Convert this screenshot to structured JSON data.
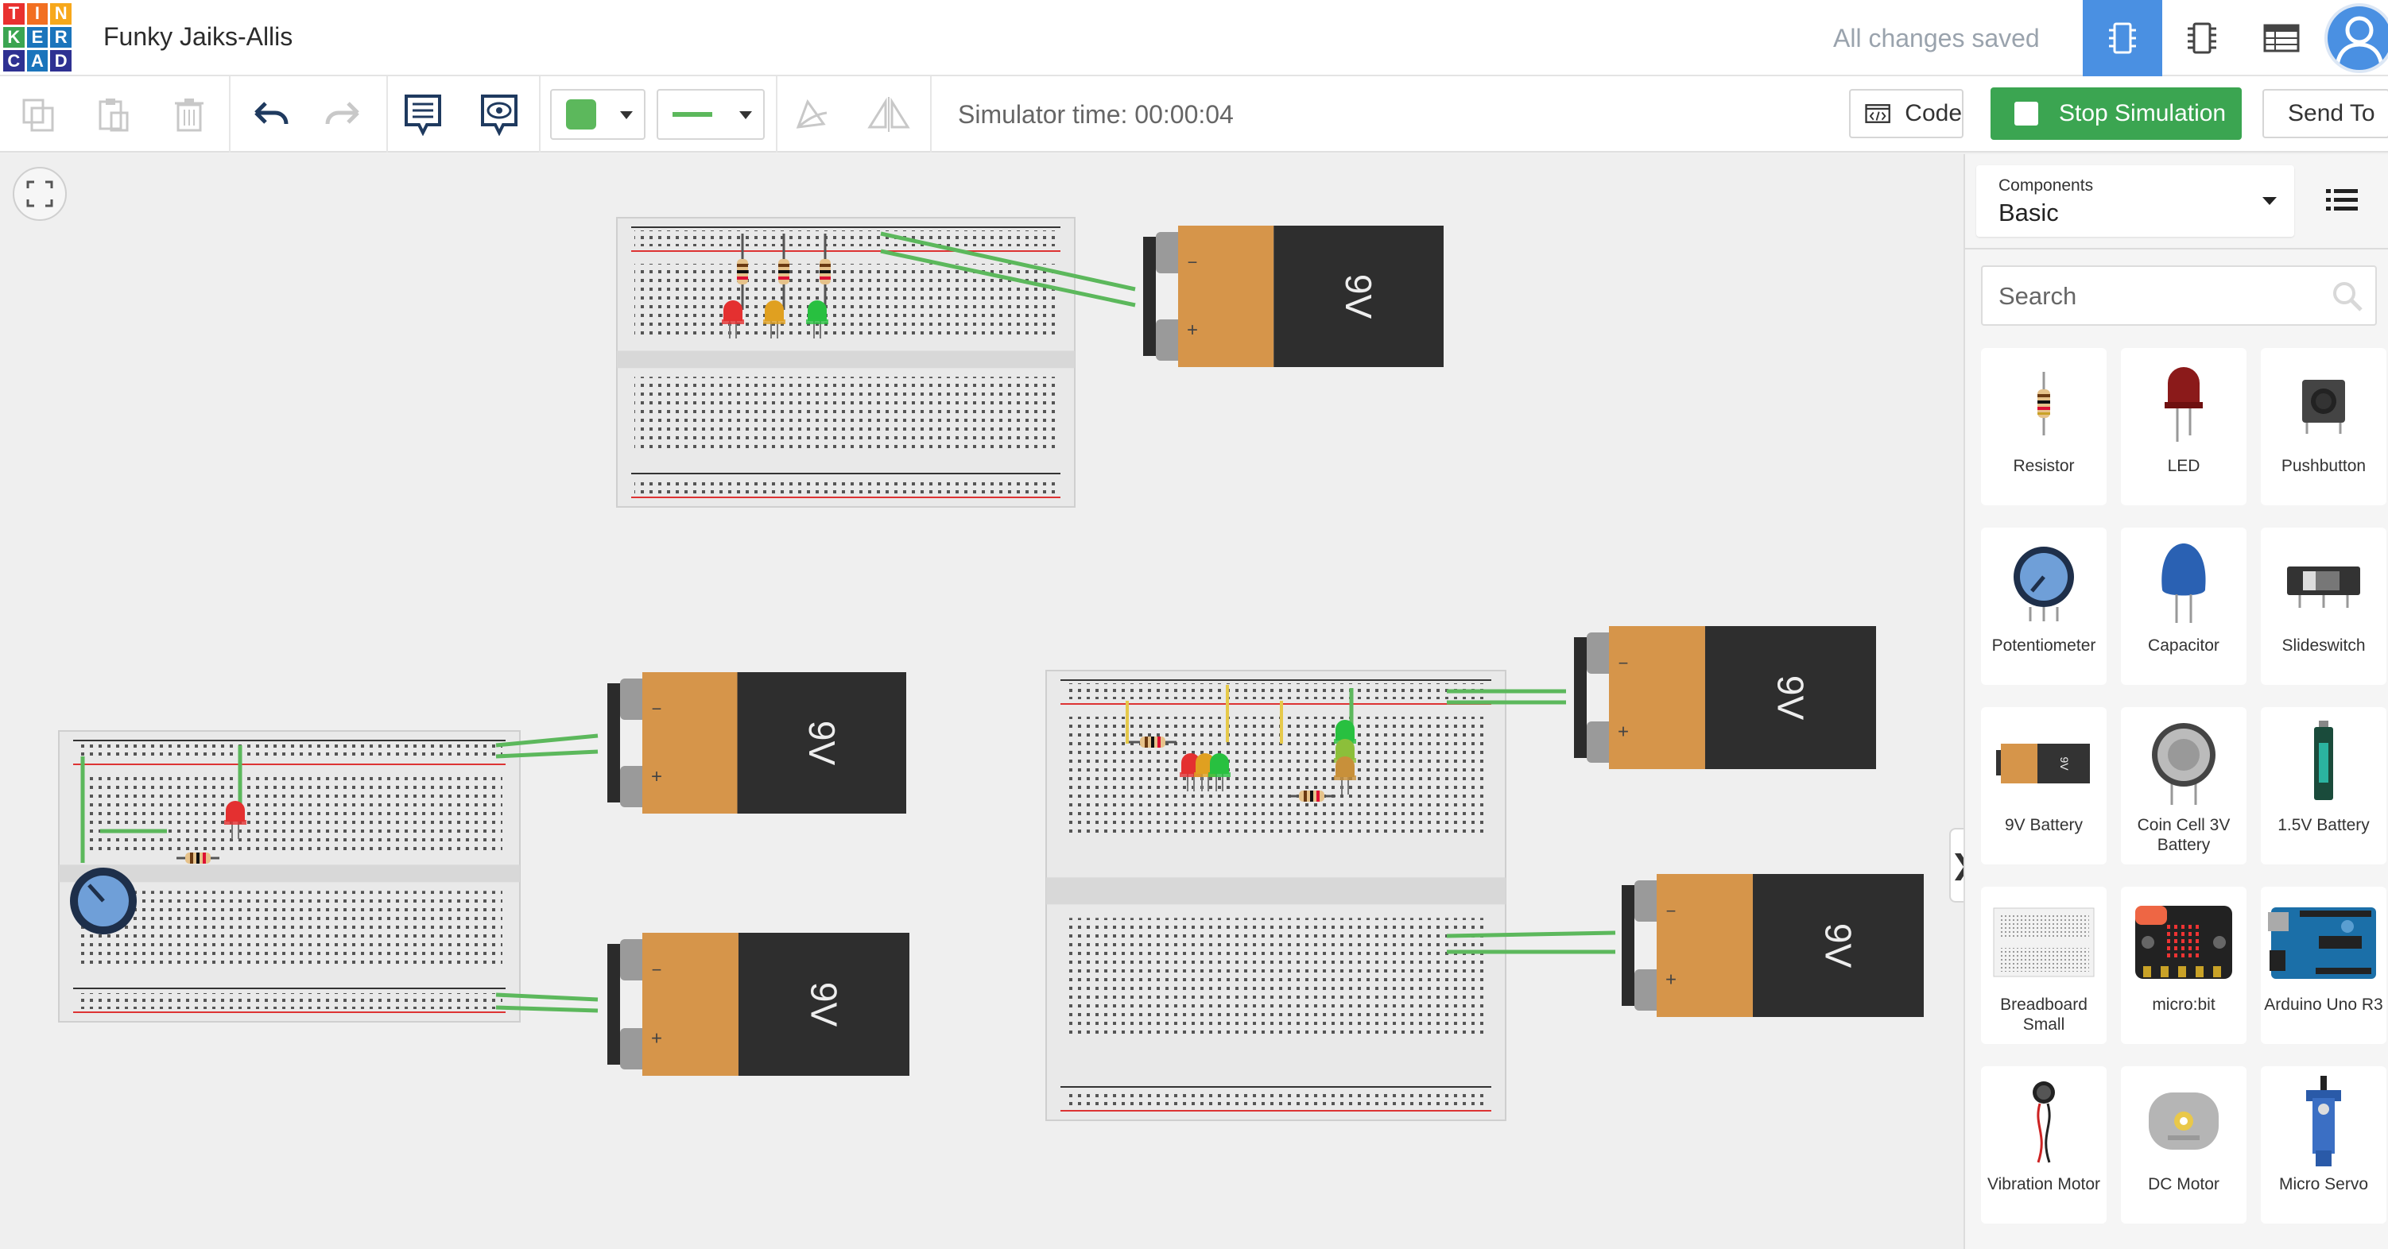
{
  "app": {
    "logo_letters": [
      "T",
      "I",
      "N",
      "K",
      "E",
      "R",
      "C",
      "A",
      "D"
    ],
    "logo_colors": [
      "#e9312f",
      "#f26f21",
      "#f7a81b",
      "#3ba551",
      "#1b75bc",
      "#1b75bc",
      "#2e3192",
      "#1b75bc",
      "#2e3192"
    ]
  },
  "header": {
    "project_title": "Funky Jaiks-Allis",
    "save_status": "All changes saved",
    "views": [
      "circuit-view",
      "schematic-view",
      "component-list-view"
    ]
  },
  "toolbar": {
    "simulator_time": "Simulator time: 00:00:04",
    "code_label": "Code",
    "stop_label": "Stop Simulation",
    "send_label": "Send To",
    "wire_color": "#5cb85c"
  },
  "canvas": {
    "battery_label": "9V",
    "minus_sign": "−",
    "plus_sign": "+"
  },
  "panel": {
    "components_label": "Components",
    "components_value": "Basic",
    "search_placeholder": "Search",
    "items": [
      {
        "label": "Resistor",
        "icon": "resistor-icon"
      },
      {
        "label": "LED",
        "icon": "led-icon"
      },
      {
        "label": "Pushbutton",
        "icon": "pushbutton-icon"
      },
      {
        "label": "Potentiometer",
        "icon": "potentiometer-icon"
      },
      {
        "label": "Capacitor",
        "icon": "capacitor-icon"
      },
      {
        "label": "Slideswitch",
        "icon": "slideswitch-icon"
      },
      {
        "label": "9V Battery",
        "icon": "battery-9v-icon"
      },
      {
        "label": "Coin Cell 3V Battery",
        "icon": "coin-cell-icon"
      },
      {
        "label": "1.5V Battery",
        "icon": "battery-aa-icon"
      },
      {
        "label": "Breadboard Small",
        "icon": "breadboard-icon"
      },
      {
        "label": "micro:bit",
        "icon": "microbit-icon"
      },
      {
        "label": "Arduino Uno R3",
        "icon": "arduino-icon"
      },
      {
        "label": "Vibration Motor",
        "icon": "vibration-motor-icon"
      },
      {
        "label": "DC Motor",
        "icon": "dc-motor-icon"
      },
      {
        "label": "Micro Servo",
        "icon": "micro-servo-icon"
      }
    ]
  }
}
